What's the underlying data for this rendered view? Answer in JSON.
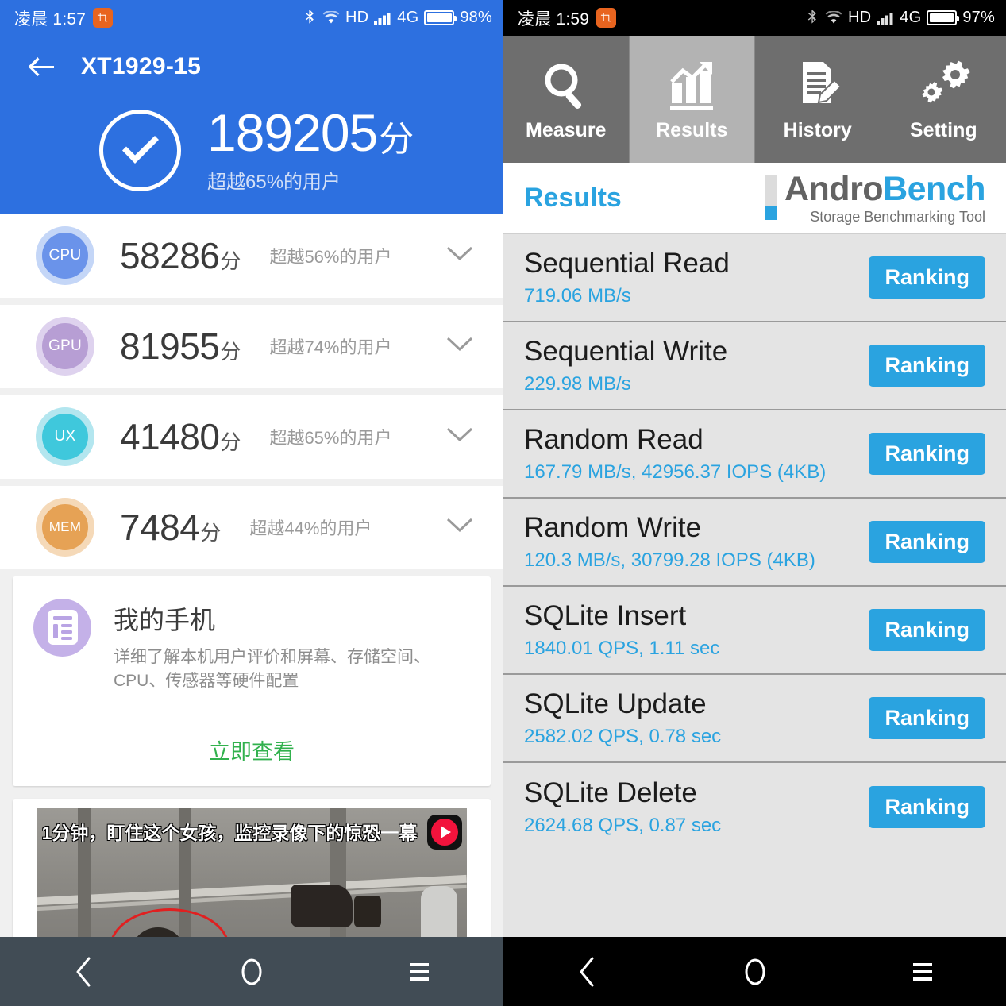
{
  "left": {
    "statusbar": {
      "time": "凌晨 1:57",
      "screenshot_icon": "screenshot-icon",
      "icons": [
        "bluetooth-icon",
        "wifi-icon",
        "signal-icon"
      ],
      "hd_label": "HD",
      "network_label": "4G",
      "battery_label": "98%",
      "battery_percent": 98
    },
    "header": {
      "back_icon": "back-arrow-icon",
      "device_title": "XT1929-15",
      "check_icon": "check-circle-icon",
      "total_score": "189205",
      "score_unit": "分",
      "score_subtitle": "超越65%的用户"
    },
    "scores": [
      {
        "badge": "CPU",
        "badge_color": "#6a93ea",
        "ring_color": "#c4d6f7",
        "value": "58286",
        "unit": "分",
        "percentile": "超越56%的用户",
        "chevron": "chevron-down-icon"
      },
      {
        "badge": "GPU",
        "badge_color": "#b79ed4",
        "ring_color": "#ded2ee",
        "value": "81955",
        "unit": "分",
        "percentile": "超越74%的用户",
        "chevron": "chevron-down-icon"
      },
      {
        "badge": "UX",
        "badge_color": "#3fc8dc",
        "ring_color": "#b3e6ef",
        "value": "41480",
        "unit": "分",
        "percentile": "超越65%的用户",
        "chevron": "chevron-down-icon"
      },
      {
        "badge": "MEM",
        "badge_color": "#e6a255",
        "ring_color": "#f5d9b8",
        "value": "7484",
        "unit": "分",
        "percentile": "超越44%的用户",
        "chevron": "chevron-down-icon"
      }
    ],
    "phone_card": {
      "icon": "document-list-icon",
      "title": "我的手机",
      "description": "详细了解本机用户评价和屏幕、存储空间、CPU、传感器等硬件配置",
      "action_label": "立即查看",
      "action_color": "#31b14d"
    },
    "ad_card": {
      "caption": "1分钟，盯住这个女孩，监控录像下的惊恐一幕",
      "play_icon": "play-button-icon"
    },
    "navbar": {
      "background": "#414c55",
      "back_icon": "nav-back-icon",
      "home_icon": "nav-home-icon",
      "menu_icon": "nav-menu-icon"
    }
  },
  "right": {
    "statusbar": {
      "time": "凌晨 1:59",
      "screenshot_icon": "screenshot-icon",
      "icons": [
        "bluetooth-icon",
        "wifi-icon",
        "signal-icon"
      ],
      "hd_label": "HD",
      "network_label": "4G",
      "battery_label": "97%",
      "battery_percent": 97
    },
    "tabs": [
      {
        "label": "Measure",
        "icon": "magnifier-icon",
        "active": false
      },
      {
        "label": "Results",
        "icon": "bar-chart-icon",
        "active": true
      },
      {
        "label": "History",
        "icon": "document-pencil-icon",
        "active": false
      },
      {
        "label": "Setting",
        "icon": "gears-icon",
        "active": false
      }
    ],
    "header": {
      "title": "Results",
      "title_color": "#2aa3e0",
      "logo_andro": "Andro",
      "logo_bench": "Bench",
      "logo_tagline": "Storage Benchmarking Tool"
    },
    "results": [
      {
        "name": "Sequential Read",
        "value": "719.06 MB/s",
        "button": "Ranking"
      },
      {
        "name": "Sequential Write",
        "value": "229.98 MB/s",
        "button": "Ranking"
      },
      {
        "name": "Random Read",
        "value": "167.79 MB/s, 42956.37 IOPS (4KB)",
        "button": "Ranking"
      },
      {
        "name": "Random Write",
        "value": "120.3 MB/s, 30799.28 IOPS (4KB)",
        "button": "Ranking"
      },
      {
        "name": "SQLite Insert",
        "value": "1840.01 QPS, 1.11 sec",
        "button": "Ranking"
      },
      {
        "name": "SQLite Update",
        "value": "2582.02 QPS, 0.78 sec",
        "button": "Ranking"
      },
      {
        "name": "SQLite Delete",
        "value": "2624.68 QPS, 0.87 sec",
        "button": "Ranking"
      }
    ],
    "navbar": {
      "background": "#000000",
      "back_icon": "nav-back-icon",
      "home_icon": "nav-home-icon",
      "menu_icon": "nav-menu-icon"
    }
  },
  "colors": {
    "antutu_blue": "#2d70e0",
    "androbench_blue": "#2aa3e0",
    "tab_inactive": "#6e6e6e",
    "tab_active": "#b3b3b3",
    "list_bg": "#e4e4e4"
  }
}
